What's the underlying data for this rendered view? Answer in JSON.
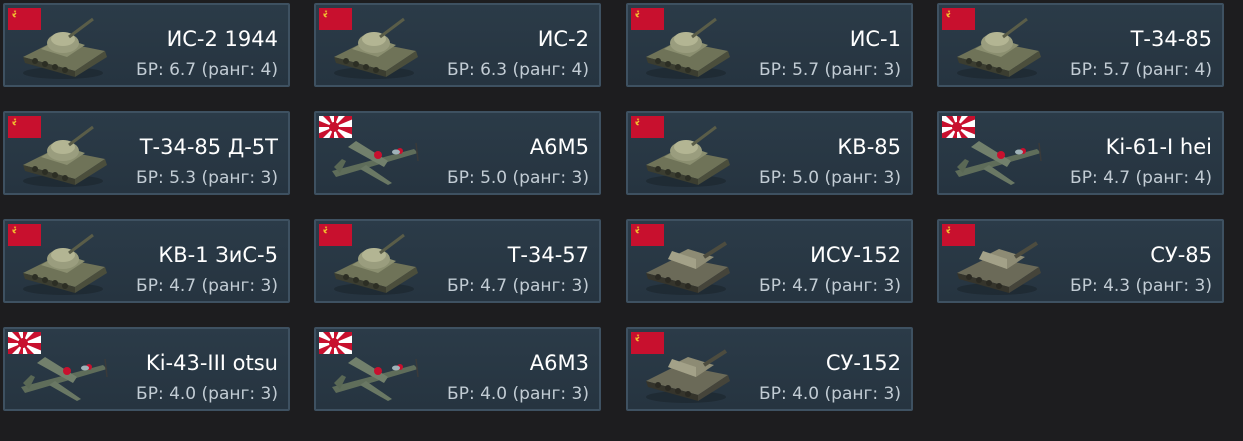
{
  "colors": {
    "card_background": "#283845",
    "card_border": "#3e5161",
    "name_text": "#ffffff",
    "br_text": "#c2ccd4",
    "ussr_flag": "#c8102e",
    "japan_flag_rays": "#c8102e"
  },
  "vehicles": [
    {
      "name": "ИС-2 1944",
      "br": "БР: 6.7 (ранг: 4)",
      "flag": "ussr-flag-icon",
      "kind": "tank"
    },
    {
      "name": "ИС-2",
      "br": "БР: 6.3 (ранг: 4)",
      "flag": "ussr-flag-icon",
      "kind": "tank"
    },
    {
      "name": "ИС-1",
      "br": "БР: 5.7 (ранг: 3)",
      "flag": "ussr-flag-icon",
      "kind": "tank"
    },
    {
      "name": "Т-34-85",
      "br": "БР: 5.7 (ранг: 4)",
      "flag": "ussr-flag-icon",
      "kind": "tank"
    },
    {
      "name": "Т-34-85 Д-5Т",
      "br": "БР: 5.3 (ранг: 3)",
      "flag": "ussr-flag-icon",
      "kind": "tank"
    },
    {
      "name": "A6M5",
      "br": "БР: 5.0 (ранг: 3)",
      "flag": "japan-flag-icon",
      "kind": "plane"
    },
    {
      "name": "КВ-85",
      "br": "БР: 5.0 (ранг: 3)",
      "flag": "ussr-flag-icon",
      "kind": "tank"
    },
    {
      "name": "Ki-61-I hei",
      "br": "БР: 4.7 (ранг: 4)",
      "flag": "japan-flag-icon",
      "kind": "plane"
    },
    {
      "name": "КВ-1 ЗиС-5",
      "br": "БР: 4.7 (ранг: 3)",
      "flag": "ussr-flag-icon",
      "kind": "tank"
    },
    {
      "name": "Т-34-57",
      "br": "БР: 4.7 (ранг: 3)",
      "flag": "ussr-flag-icon",
      "kind": "tank"
    },
    {
      "name": "ИСУ-152",
      "br": "БР: 4.7 (ранг: 3)",
      "flag": "ussr-flag-icon",
      "kind": "spg"
    },
    {
      "name": "СУ-85",
      "br": "БР: 4.3 (ранг: 3)",
      "flag": "ussr-flag-icon",
      "kind": "spg"
    },
    {
      "name": "Ki-43-III otsu",
      "br": "БР: 4.0 (ранг: 3)",
      "flag": "japan-flag-icon",
      "kind": "plane"
    },
    {
      "name": "A6M3",
      "br": "БР: 4.0 (ранг: 3)",
      "flag": "japan-flag-icon",
      "kind": "plane"
    },
    {
      "name": "СУ-152",
      "br": "БР: 4.0 (ранг: 3)",
      "flag": "ussr-flag-icon",
      "kind": "spg"
    }
  ]
}
